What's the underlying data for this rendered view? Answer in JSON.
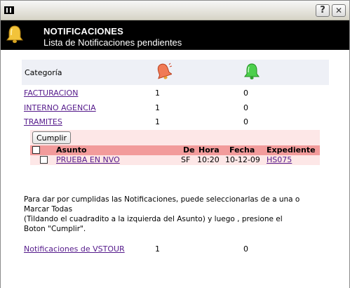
{
  "titlebar": {
    "system_icon": "pause-icon",
    "help_label": "?",
    "close_label": "✕"
  },
  "header": {
    "title": "NOTIFICACIONES",
    "subtitle": "Lista de Notificaciones pendientes",
    "icon": "yellow-bell-icon"
  },
  "categories": {
    "label": "Categoría",
    "pending_icon": "red-bell-icon",
    "done_icon": "green-bell-icon",
    "items": [
      {
        "name": "FACTURACION ",
        "pending": "1",
        "done": "0"
      },
      {
        "name": "INTERNO AGENCIA ",
        "pending": "1",
        "done": "0"
      },
      {
        "name": "TRAMITES ",
        "pending": "1",
        "done": "0"
      }
    ]
  },
  "pending_table": {
    "button_label": "Cumplir",
    "headers": {
      "asunto": "Asunto",
      "de": "De",
      "hora": "Hora",
      "fecha": "Fecha",
      "expediente": "Expediente"
    },
    "rows": [
      {
        "asunto": "PRUEBA EN NVO ",
        "de": "SF",
        "hora": "10:20",
        "fecha": "10-12-09",
        "expediente": "HS075"
      }
    ]
  },
  "instructions": {
    "line1": "Para dar por cumplidas las Notificaciones, puede seleccionarlas de a una o",
    "line2": "Marcar Todas",
    "line3": "(Tildando el cuadradito a la izquierda del Asunto) y luego , presione el",
    "line4": "Boton \"Cumplir\"."
  },
  "vstour": {
    "name": "Notificaciones de VSTOUR ",
    "pending": "1",
    "done": "0"
  },
  "colors": {
    "header_bg": "#000000",
    "link": "#551a8b",
    "table_header": "#f29b9b",
    "table_bg": "#fde7e7",
    "category_bg": "#eef0f6"
  }
}
